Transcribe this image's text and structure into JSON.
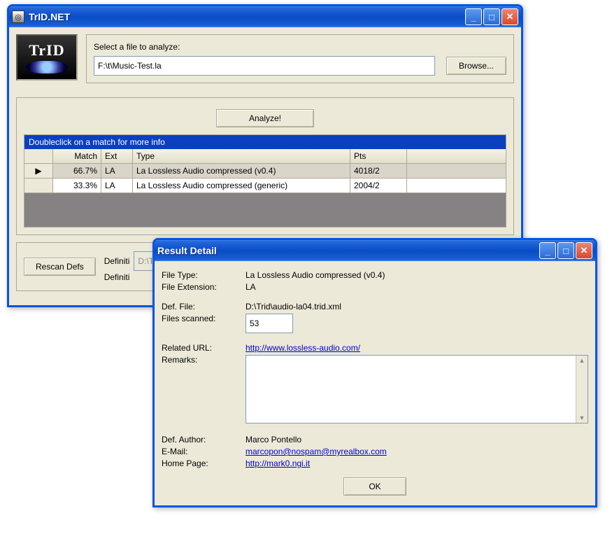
{
  "main": {
    "title": "TrID.NET",
    "selectLabel": "Select a file to analyze:",
    "filePath": "F:\\t\\Music-Test.la",
    "browse": "Browse...",
    "analyze": "Analyze!",
    "gridHint": "Doubleclick on a match for more info",
    "cols": {
      "match": "Match",
      "ext": "Ext",
      "type": "Type",
      "pts": "Pts"
    },
    "rows": [
      {
        "marker": "▶",
        "match": "66.7%",
        "ext": "LA",
        "type": "La Lossless Audio compressed (v0.4)",
        "pts": "4018/2"
      },
      {
        "marker": "",
        "match": "33.3%",
        "ext": "LA",
        "type": "La Lossless Audio compressed (generic)",
        "pts": "2004/2"
      }
    ],
    "rescan": "Rescan Defs",
    "defPathLabel": "Definiti",
    "defPath": "D:\\Trid",
    "defCountLabel": "Definiti"
  },
  "dialog": {
    "title": "Result Detail",
    "labels": {
      "fileType": "File Type:",
      "fileExt": "File Extension:",
      "defFile": "Def. File:",
      "filesScanned": "Files scanned:",
      "relUrl": "Related URL:",
      "remarks": "Remarks:",
      "defAuthor": "Def. Author:",
      "email": "E-Mail:",
      "homePage": "Home Page:"
    },
    "values": {
      "fileType": "La Lossless Audio compressed (v0.4)",
      "fileExt": "LA",
      "defFile": "D:\\Trid\\audio-la04.trid.xml",
      "filesScanned": "53",
      "relUrl": "http://www.lossless-audio.com/",
      "remarks": "",
      "defAuthor": "Marco Pontello",
      "email": "marcopon@nospam@myrealbox.com",
      "homePage": "http://mark0.ngi.it"
    },
    "ok": "OK"
  }
}
